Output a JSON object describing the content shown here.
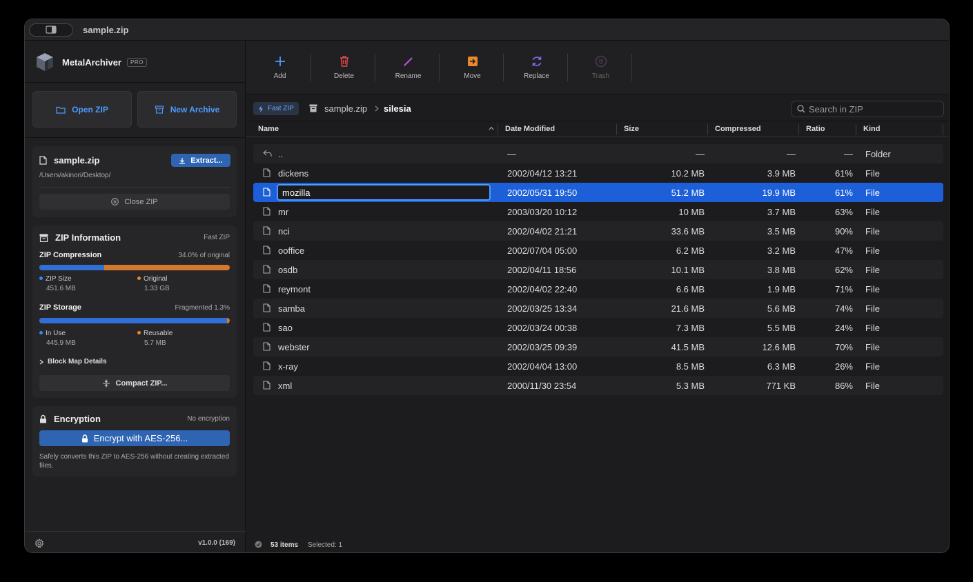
{
  "window": {
    "title": "sample.zip"
  },
  "brand": {
    "name": "MetalArchiver",
    "badge": "PRO"
  },
  "sidebar": {
    "open_zip_label": "Open ZIP",
    "new_archive_label": "New Archive",
    "file": {
      "name": "sample.zip",
      "path": "/Users/akinori/Desktop/",
      "extract_label": "Extract...",
      "close_label": "Close ZIP"
    },
    "info": {
      "title": "ZIP Information",
      "mode": "Fast ZIP",
      "compression": {
        "label": "ZIP Compression",
        "summary": "34.0% of original",
        "fraction": 0.34,
        "zip_size_label": "ZIP Size",
        "zip_size_value": "451.6 MB",
        "original_label": "Original",
        "original_value": "1.33 GB"
      },
      "storage": {
        "label": "ZIP Storage",
        "summary": "Fragmented 1.3%",
        "in_use_fraction": 0.987,
        "in_use_label": "In Use",
        "in_use_value": "445.9 MB",
        "reusable_label": "Reusable",
        "reusable_value": "5.7 MB"
      },
      "block_map_label": "Block Map Details",
      "compact_label": "Compact ZIP..."
    },
    "encryption": {
      "title": "Encryption",
      "status": "No encryption",
      "button_label": "Encrypt with AES-256...",
      "note": "Safely converts this ZIP to AES-256 without creating extracted files."
    },
    "version": "v1.0.0 (169)"
  },
  "toolbar": {
    "add": "Add",
    "delete": "Delete",
    "rename": "Rename",
    "move": "Move",
    "replace": "Replace",
    "trash": "Trash"
  },
  "pathbar": {
    "badge": "Fast ZIP",
    "crumbs": [
      "sample.zip",
      "silesia"
    ],
    "search_placeholder": "Search in ZIP"
  },
  "table": {
    "headers": {
      "name": "Name",
      "date": "Date Modified",
      "size": "Size",
      "compressed": "Compressed",
      "ratio": "Ratio",
      "kind": "Kind"
    },
    "parent": {
      "name": "..",
      "date": "—",
      "size": "—",
      "compressed": "—",
      "ratio": "—",
      "kind": "Folder"
    },
    "rows": [
      {
        "name": "dickens",
        "date": "2002/04/12 13:21",
        "size": "10.2 MB",
        "compressed": "3.9 MB",
        "ratio": "61%",
        "kind": "File"
      },
      {
        "name": "mozilla",
        "date": "2002/05/31 19:50",
        "size": "51.2 MB",
        "compressed": "19.9 MB",
        "ratio": "61%",
        "kind": "File"
      },
      {
        "name": "mr",
        "date": "2003/03/20 10:12",
        "size": "10 MB",
        "compressed": "3.7 MB",
        "ratio": "63%",
        "kind": "File"
      },
      {
        "name": "nci",
        "date": "2002/04/02 21:21",
        "size": "33.6 MB",
        "compressed": "3.5 MB",
        "ratio": "90%",
        "kind": "File"
      },
      {
        "name": "ooffice",
        "date": "2002/07/04 05:00",
        "size": "6.2 MB",
        "compressed": "3.2 MB",
        "ratio": "47%",
        "kind": "File"
      },
      {
        "name": "osdb",
        "date": "2002/04/11 18:56",
        "size": "10.1 MB",
        "compressed": "3.8 MB",
        "ratio": "62%",
        "kind": "File"
      },
      {
        "name": "reymont",
        "date": "2002/04/02 22:40",
        "size": "6.6 MB",
        "compressed": "1.9 MB",
        "ratio": "71%",
        "kind": "File"
      },
      {
        "name": "samba",
        "date": "2002/03/25 13:34",
        "size": "21.6 MB",
        "compressed": "5.6 MB",
        "ratio": "74%",
        "kind": "File"
      },
      {
        "name": "sao",
        "date": "2002/03/24 00:38",
        "size": "7.3 MB",
        "compressed": "5.5 MB",
        "ratio": "24%",
        "kind": "File"
      },
      {
        "name": "webster",
        "date": "2002/03/25 09:39",
        "size": "41.5 MB",
        "compressed": "12.6 MB",
        "ratio": "70%",
        "kind": "File"
      },
      {
        "name": "x-ray",
        "date": "2002/04/04 13:00",
        "size": "8.5 MB",
        "compressed": "6.3 MB",
        "ratio": "26%",
        "kind": "File"
      },
      {
        "name": "xml",
        "date": "2000/11/30 23:54",
        "size": "5.3 MB",
        "compressed": "771 KB",
        "ratio": "86%",
        "kind": "File"
      }
    ],
    "selected_index": 1,
    "rename_value": "mozilla"
  },
  "status": {
    "count": "53 items",
    "selected": "Selected: 1"
  },
  "colors": {
    "accent": "#4c9bff",
    "selection": "#1d5fd8",
    "delete": "#e5484d",
    "rename": "#c251e0",
    "move": "#e8892d",
    "replace": "#7a6cf0"
  }
}
